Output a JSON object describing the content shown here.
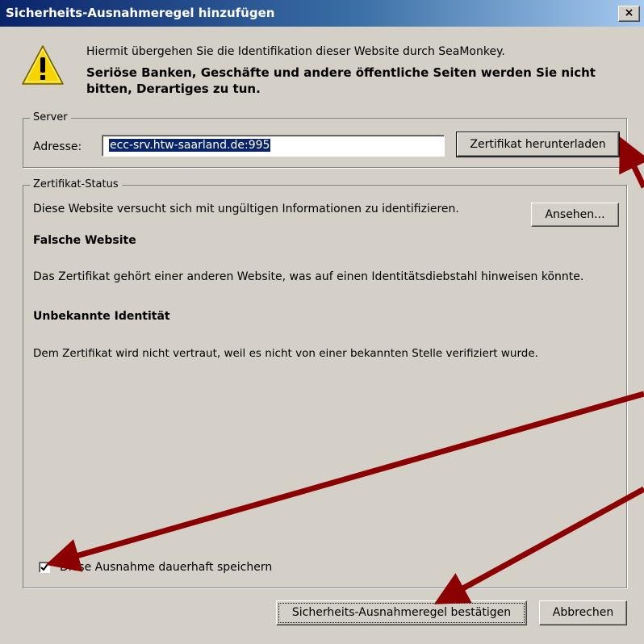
{
  "window": {
    "title": "Sicherheits-Ausnahmeregel hinzufügen",
    "close_label": "×"
  },
  "header": {
    "info": "Hiermit übergehen Sie die Identifikation dieser Website durch SeaMonkey.",
    "warning": "Seriöse Banken, Geschäfte und andere öffentliche Seiten werden Sie nicht bitten, Derartiges zu tun."
  },
  "server": {
    "legend": "Server",
    "address_label": "Adresse:",
    "address_value": "ecc-srv.htw-saarland.de:995",
    "download_button": "Zertifikat herunterladen"
  },
  "status": {
    "legend": "Zertifikat-Status",
    "intro": "Diese Website versucht sich mit ungültigen Informationen zu identifizieren.",
    "view_button": "Ansehen...",
    "wrong_site_title": "Falsche Website",
    "wrong_site_text": "Das Zertifikat gehört einer anderen Website, was auf einen Identitätsdiebstahl hinweisen könnte.",
    "unknown_identity_title": "Unbekannte Identität",
    "unknown_identity_text": "Dem Zertifikat wird nicht vertraut, weil es nicht von einer bekannten Stelle verifiziert wurde.",
    "permanent_checkbox_label": "Diese Ausnahme dauerhaft speichern",
    "permanent_checked": true
  },
  "footer": {
    "confirm_button": "Sicherheits-Ausnahmeregel bestätigen",
    "cancel_button": "Abbrechen"
  },
  "colors": {
    "dialog_bg": "#d4d0c8",
    "title_bar": "#0a246a",
    "selection": "#0a246a",
    "annotation_arrow": "#8b0000",
    "warning_yellow": "#f6d400"
  },
  "icons": {
    "warning": "warning-triangle-icon",
    "checkmark": "checkmark-icon",
    "close": "close-icon"
  }
}
